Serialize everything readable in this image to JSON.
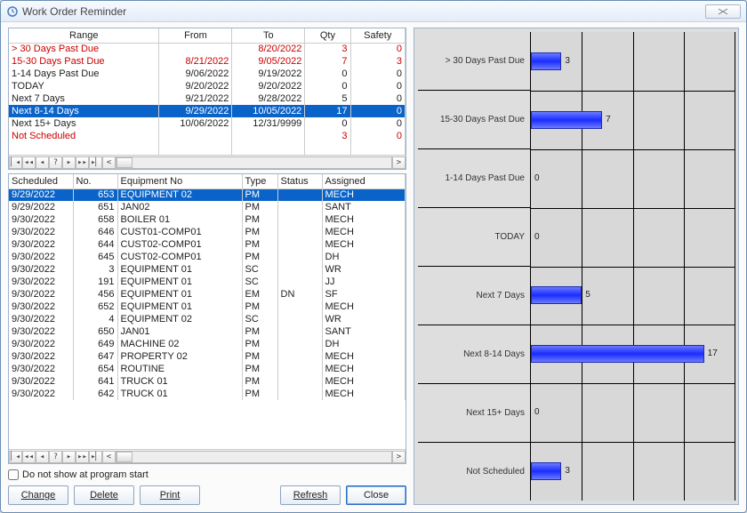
{
  "window_title": "Work Order Reminder",
  "summary": {
    "columns": [
      "Range",
      "From",
      "To",
      "Qty",
      "Safety"
    ],
    "rows": [
      {
        "range": "> 30 Days Past Due",
        "from": "",
        "to": "8/20/2022",
        "qty": "3",
        "safety": "0",
        "red": true,
        "sel": false
      },
      {
        "range": "15-30 Days Past Due",
        "from": "8/21/2022",
        "to": "9/05/2022",
        "qty": "7",
        "safety": "3",
        "red": true,
        "sel": false
      },
      {
        "range": "1-14 Days Past Due",
        "from": "9/06/2022",
        "to": "9/19/2022",
        "qty": "0",
        "safety": "0",
        "red": false,
        "sel": false
      },
      {
        "range": "TODAY",
        "from": "9/20/2022",
        "to": "9/20/2022",
        "qty": "0",
        "safety": "0",
        "red": false,
        "sel": false
      },
      {
        "range": "Next 7 Days",
        "from": "9/21/2022",
        "to": "9/28/2022",
        "qty": "5",
        "safety": "0",
        "red": false,
        "sel": false
      },
      {
        "range": "Next 8-14 Days",
        "from": "9/29/2022",
        "to": "10/05/2022",
        "qty": "17",
        "safety": "0",
        "red": false,
        "sel": true
      },
      {
        "range": "Next 15+ Days",
        "from": "10/06/2022",
        "to": "12/31/9999",
        "qty": "0",
        "safety": "0",
        "red": false,
        "sel": false
      },
      {
        "range": "Not Scheduled",
        "from": "",
        "to": "",
        "qty": "3",
        "safety": "0",
        "red": true,
        "sel": false
      }
    ]
  },
  "detail": {
    "columns": [
      "Scheduled",
      "No.",
      "Equipment No",
      "Type",
      "Status",
      "Assigned"
    ],
    "rows": [
      {
        "sch": "9/29/2022",
        "no": "653",
        "eq": "EQUIPMENT 02",
        "type": "PM",
        "status": "",
        "asg": "MECH",
        "sel": true
      },
      {
        "sch": "9/29/2022",
        "no": "651",
        "eq": "JAN02",
        "type": "PM",
        "status": "",
        "asg": "SANT"
      },
      {
        "sch": "9/30/2022",
        "no": "658",
        "eq": "BOILER 01",
        "type": "PM",
        "status": "",
        "asg": "MECH"
      },
      {
        "sch": "9/30/2022",
        "no": "646",
        "eq": "CUST01-COMP01",
        "type": "PM",
        "status": "",
        "asg": "MECH"
      },
      {
        "sch": "9/30/2022",
        "no": "644",
        "eq": "CUST02-COMP01",
        "type": "PM",
        "status": "",
        "asg": "MECH"
      },
      {
        "sch": "9/30/2022",
        "no": "645",
        "eq": "CUST02-COMP01",
        "type": "PM",
        "status": "",
        "asg": "DH"
      },
      {
        "sch": "9/30/2022",
        "no": "3",
        "eq": "EQUIPMENT 01",
        "type": "SC",
        "status": "",
        "asg": "WR"
      },
      {
        "sch": "9/30/2022",
        "no": "191",
        "eq": "EQUIPMENT 01",
        "type": "SC",
        "status": "",
        "asg": "JJ"
      },
      {
        "sch": "9/30/2022",
        "no": "456",
        "eq": "EQUIPMENT 01",
        "type": "EM",
        "status": "DN",
        "asg": "SF"
      },
      {
        "sch": "9/30/2022",
        "no": "652",
        "eq": "EQUIPMENT 01",
        "type": "PM",
        "status": "",
        "asg": "MECH"
      },
      {
        "sch": "9/30/2022",
        "no": "4",
        "eq": "EQUIPMENT 02",
        "type": "SC",
        "status": "",
        "asg": "WR"
      },
      {
        "sch": "9/30/2022",
        "no": "650",
        "eq": "JAN01",
        "type": "PM",
        "status": "",
        "asg": "SANT"
      },
      {
        "sch": "9/30/2022",
        "no": "649",
        "eq": "MACHINE 02",
        "type": "PM",
        "status": "",
        "asg": "DH"
      },
      {
        "sch": "9/30/2022",
        "no": "647",
        "eq": "PROPERTY 02",
        "type": "PM",
        "status": "",
        "asg": "MECH"
      },
      {
        "sch": "9/30/2022",
        "no": "654",
        "eq": "ROUTINE",
        "type": "PM",
        "status": "",
        "asg": "MECH"
      },
      {
        "sch": "9/30/2022",
        "no": "641",
        "eq": "TRUCK 01",
        "type": "PM",
        "status": "",
        "asg": "MECH"
      },
      {
        "sch": "9/30/2022",
        "no": "642",
        "eq": "TRUCK 01",
        "type": "PM",
        "status": "",
        "asg": "MECH"
      }
    ]
  },
  "checkbox_label": "Do not show at program start",
  "buttons": {
    "change": "Change",
    "delete": "Delete",
    "print": "Print",
    "refresh": "Refresh",
    "close": "Close"
  },
  "chart_data": {
    "type": "bar",
    "orientation": "horizontal",
    "categories": [
      "> 30 Days Past Due",
      "15-30 Days Past Due",
      "1-14 Days Past Due",
      "TODAY",
      "Next 7 Days",
      "Next 8-14 Days",
      "Next 15+ Days",
      "Not Scheduled"
    ],
    "values": [
      3,
      7,
      0,
      0,
      5,
      17,
      0,
      3
    ],
    "xmax": 20,
    "grid_interval": 5
  }
}
